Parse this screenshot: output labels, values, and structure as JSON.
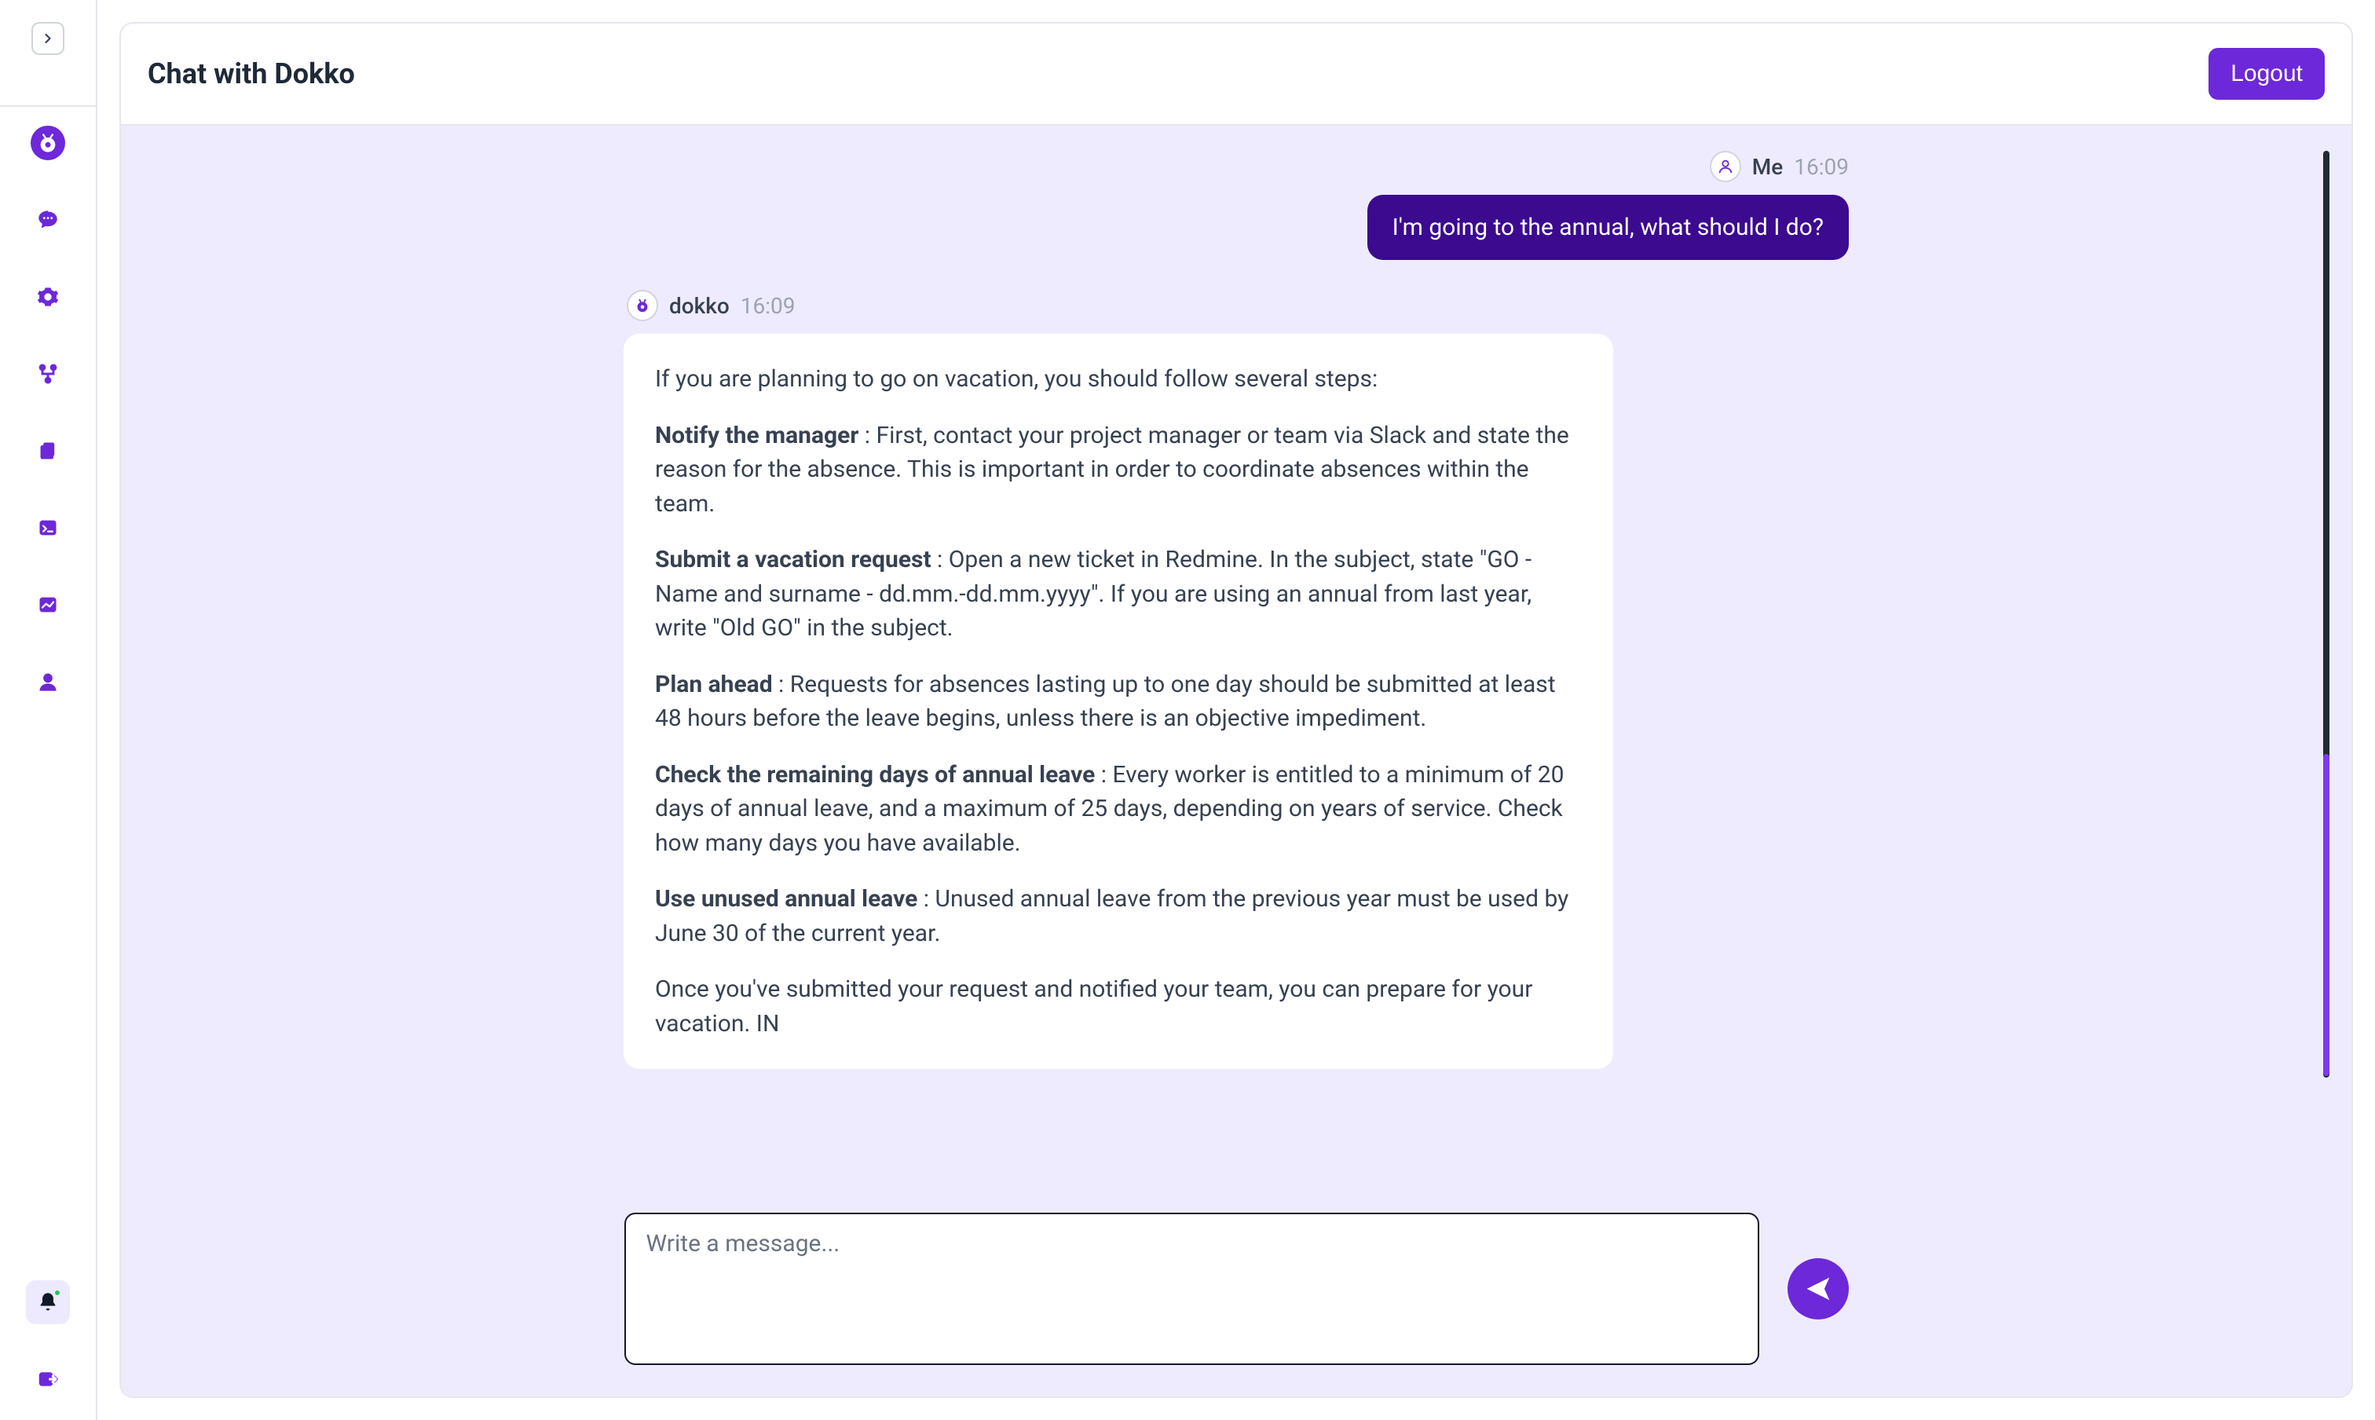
{
  "colors": {
    "primary": "#6d28d9",
    "userBubble": "#3b0a8f",
    "chatBg": "#efebff"
  },
  "sidebar": {
    "items": [
      {
        "name": "dokko-logo",
        "active": true
      },
      {
        "name": "chat-icon"
      },
      {
        "name": "settings-icon"
      },
      {
        "name": "pipeline-icon"
      },
      {
        "name": "documents-icon"
      },
      {
        "name": "terminal-icon"
      },
      {
        "name": "analytics-icon"
      },
      {
        "name": "account-icon"
      }
    ]
  },
  "header": {
    "title": "Chat with Dokko",
    "logout": "Logout"
  },
  "messages": {
    "user": {
      "name": "Me",
      "time": "16:09",
      "text": "I'm going to the annual, what should I do?"
    },
    "bot": {
      "name": "dokko",
      "time": "16:09",
      "intro": "If you are planning to go on vacation, you should follow several steps:",
      "steps": [
        {
          "title": "Notify the manager",
          "body": " : First, contact your project manager or team via Slack and state the reason for the absence. This is important in order to coordinate absences within the team."
        },
        {
          "title": "Submit a vacation request",
          "body": " : Open a new ticket in Redmine. In the subject, state \"GO - Name and surname - dd.mm.-dd.mm.yyyy\". If you are using an annual from last year, write \"Old GO\" in the subject."
        },
        {
          "title": "Plan ahead",
          "body": " : Requests for absences lasting up to one day should be submitted at least 48 hours before the leave begins, unless there is an objective impediment."
        },
        {
          "title": "Check the remaining days of annual leave",
          "body": " : Every worker is entitled to a minimum of 20 days of annual leave, and a maximum of 25 days, depending on years of service. Check how many days you have available."
        },
        {
          "title": "Use unused annual leave",
          "body": " : Unused annual leave from the previous year must be used by June 30 of the current year."
        }
      ],
      "outro": "Once you've submitted your request and notified your team, you can prepare for your vacation. IN"
    }
  },
  "composer": {
    "placeholder": "Write a message..."
  }
}
